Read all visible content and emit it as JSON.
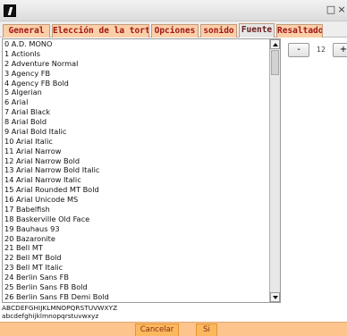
{
  "window": {
    "close_glyph": "□",
    "extra_glyph": "×"
  },
  "tabs": [
    {
      "label": "General"
    },
    {
      "label": "Elección de la tortuga"
    },
    {
      "label": "Opciones"
    },
    {
      "label": "sonido"
    },
    {
      "label": "Fuente",
      "active": true
    },
    {
      "label": "Resaltado"
    }
  ],
  "font_list": {
    "items": [
      "0 A.D. MONO",
      "1 Actionls",
      "2 Adventure Normal",
      "3 Agency FB",
      "4 Agency FB Bold",
      "5 Algerian",
      "6 Arial",
      "7 Arial Black",
      "8 Arial Bold",
      "9 Arial Bold Italic",
      "10 Arial Italic",
      "11 Arial Narrow",
      "12 Arial Narrow Bold",
      "13 Arial Narrow Bold Italic",
      "14 Arial Narrow Italic",
      "15 Arial Rounded MT Bold",
      "16 Arial Unicode MS",
      "17 Babelfish",
      "18 Baskerville Old Face",
      "19 Bauhaus 93",
      "20 Bazaronite",
      "21 Bell MT",
      "22 Bell MT Bold",
      "23 Bell MT Italic",
      "24 Berlin Sans FB",
      "25 Berlin Sans FB Bold",
      "26 Berlin Sans FB Demi Bold"
    ]
  },
  "size_control": {
    "minus_label": "-",
    "value": "12",
    "plus_label": "+"
  },
  "preview": {
    "upper": "ABCDEFGHIJKLMNOPQRSTUVWXYZ",
    "lower": "abcdefghijklmnopqrstuvwxyz"
  },
  "buttons": {
    "cancel_label": "Cancelar",
    "ok_label": "Si"
  },
  "colors": {
    "tab_bg": "#fbcfa8",
    "tab_text": "#a01818",
    "bottom_bar": "#fdc48d",
    "button_bg": "#fbb85f"
  }
}
